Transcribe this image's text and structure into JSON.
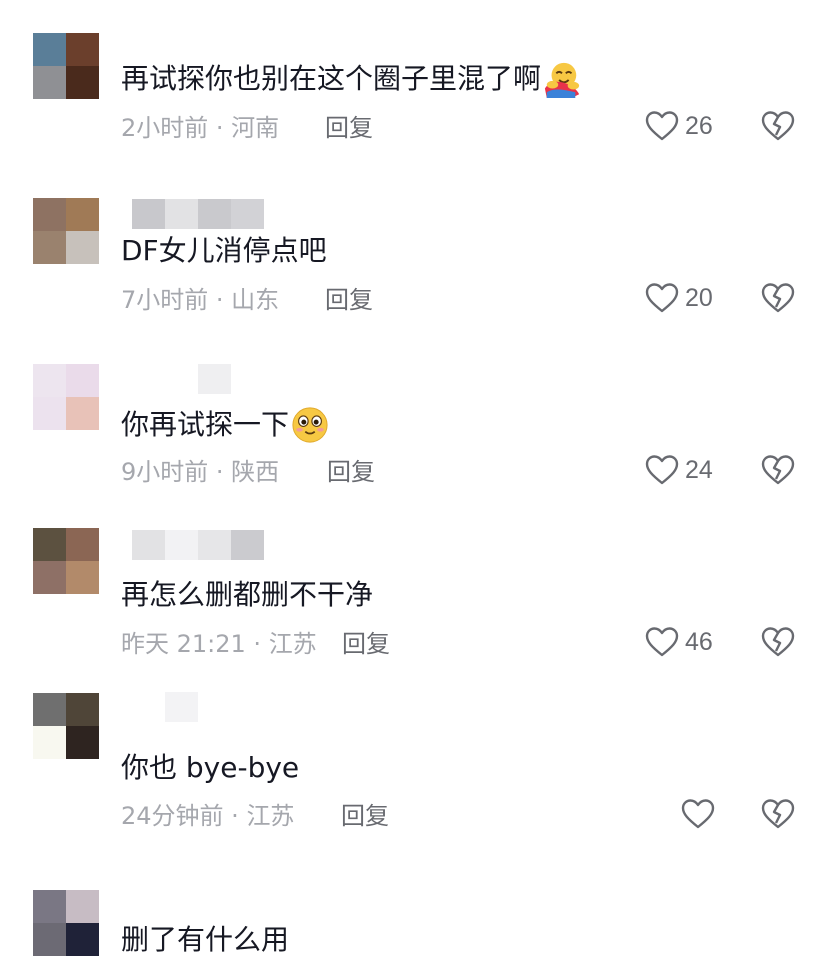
{
  "comments": [
    {
      "text": "再试探你也别在这个圈子里混了啊",
      "emoji": "hug-emoji",
      "time": "2小时前",
      "location": "河南",
      "reply": "回复",
      "likes": "26",
      "avatar_colors": [
        "#5a7e98",
        "#6b3f2c",
        "#8f9094",
        "#4a2a1c"
      ]
    },
    {
      "text": "DF女儿消停点吧",
      "time": "7小时前",
      "location": "山东",
      "reply": "回复",
      "likes": "20",
      "avatar_colors": [
        "#8e7262",
        "#a07a56",
        "#9a826e",
        "#c7c1bb"
      ]
    },
    {
      "text": "你再试探一下",
      "emoji": "smiling-emoji",
      "time": "9小时前",
      "location": "陕西",
      "reply": "回复",
      "likes": "24",
      "avatar_colors": [
        "#ede5ef",
        "#eadbea",
        "#ece2ee",
        "#e8c2b8"
      ]
    },
    {
      "text": "再怎么删都删不干净",
      "time": "昨天 21:21",
      "location": "江苏",
      "reply": "回复",
      "likes": "46",
      "avatar_colors": [
        "#5c5140",
        "#8b6654",
        "#8e7066",
        "#b28a6a"
      ]
    },
    {
      "text": "你也 bye-bye",
      "time": "24分钟前",
      "location": "江苏",
      "reply": "回复",
      "likes": "",
      "avatar_colors": [
        "#6f6f6f",
        "#4f4538",
        "#f8f8f0",
        "#2e2420"
      ]
    },
    {
      "text": "删了有什么用",
      "avatar_colors": [
        "#7a7784",
        "#c7bcc4",
        "#6c6a74",
        "#1f2238"
      ]
    }
  ],
  "colors": {
    "text": "#161823",
    "meta": "#a5a7ad",
    "action": "#686a70"
  }
}
